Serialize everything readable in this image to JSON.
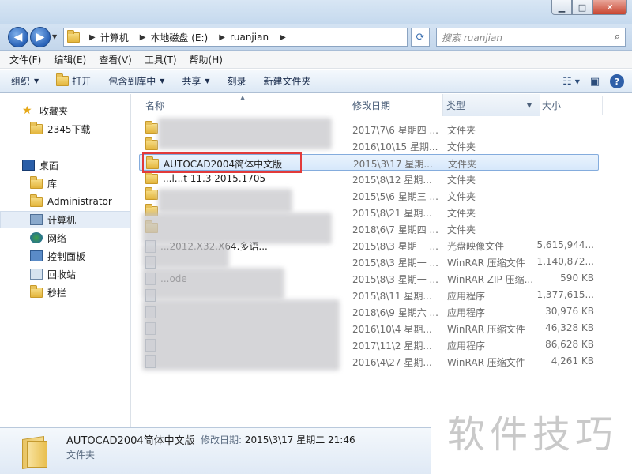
{
  "window": {
    "min": "▁",
    "max": "□",
    "close": "✕"
  },
  "address": {
    "crumbs": [
      "计算机",
      "本地磁盘 (E:)",
      "ruanjian"
    ],
    "search_placeholder": "搜索 ruanjian"
  },
  "menu": [
    "文件(F)",
    "编辑(E)",
    "查看(V)",
    "工具(T)",
    "帮助(H)"
  ],
  "toolbar": {
    "organize": "组织",
    "open": "打开",
    "include": "包含到库中",
    "share": "共享",
    "burn": "刻录",
    "newfolder": "新建文件夹",
    "help": "?"
  },
  "nav": {
    "favorites": "收藏夹",
    "fav_2345": "2345下载",
    "desktop": "桌面",
    "library": "库",
    "admin": "Administrator",
    "computer": "计算机",
    "network": "网络",
    "control": "控制面板",
    "recycle": "回收站",
    "miaolan": "秒拦"
  },
  "columns": {
    "name": "名称",
    "date": "修改日期",
    "type": "类型",
    "size": "大小"
  },
  "rows": [
    {
      "name": "",
      "date": "2017\\7\\6 星期四 ...",
      "type": "文件夹",
      "size": "",
      "icon": "folder"
    },
    {
      "name": "",
      "date": "2016\\10\\15 星期...",
      "type": "文件夹",
      "size": "",
      "icon": "folder"
    },
    {
      "name": "AUTOCAD2004简体中文版",
      "date": "2015\\3\\17 星期...",
      "type": "文件夹",
      "size": "",
      "icon": "folder"
    },
    {
      "name": "...l...t 11.3 2015.1705",
      "date": "2015\\8\\12 星期...",
      "type": "文件夹",
      "size": "",
      "icon": "folder"
    },
    {
      "name": "",
      "date": "2015\\5\\6 星期三 ...",
      "type": "文件夹",
      "size": "",
      "icon": "folder"
    },
    {
      "name": "",
      "date": "2015\\8\\21 星期...",
      "type": "文件夹",
      "size": "",
      "icon": "folder"
    },
    {
      "name": "",
      "date": "2018\\6\\7 星期四 ...",
      "type": "文件夹",
      "size": "",
      "icon": "folder"
    },
    {
      "name": "...2012.X32.X64.多语...",
      "date": "2015\\8\\3 星期一 ...",
      "type": "光盘映像文件",
      "size": "5,615,944...",
      "icon": "file"
    },
    {
      "name": "",
      "date": "2015\\8\\3 星期一 ...",
      "type": "WinRAR 压缩文件",
      "size": "1,140,872...",
      "icon": "file"
    },
    {
      "name": "...ode",
      "date": "2015\\8\\3 星期一 ...",
      "type": "WinRAR ZIP 压缩...",
      "size": "590 KB",
      "icon": "file"
    },
    {
      "name": "",
      "date": "2015\\8\\11 星期...",
      "type": "应用程序",
      "size": "1,377,615...",
      "icon": "file"
    },
    {
      "name": "",
      "date": "2018\\6\\9 星期六 ...",
      "type": "应用程序",
      "size": "30,976 KB",
      "icon": "file"
    },
    {
      "name": "",
      "date": "2016\\10\\4 星期...",
      "type": "WinRAR 压缩文件",
      "size": "46,328 KB",
      "icon": "file"
    },
    {
      "name": "",
      "date": "2017\\11\\2 星期...",
      "type": "应用程序",
      "size": "86,628 KB",
      "icon": "file"
    },
    {
      "name": "",
      "date": "2016\\4\\27 星期...",
      "type": "WinRAR 压缩文件",
      "size": "4,261 KB",
      "icon": "file"
    }
  ],
  "details": {
    "name": "AUTOCAD2004简体中文版",
    "modified_label": "修改日期:",
    "modified_value": "2015\\3\\17 星期二 21:46",
    "type": "文件夹"
  },
  "watermark": "软件技巧"
}
